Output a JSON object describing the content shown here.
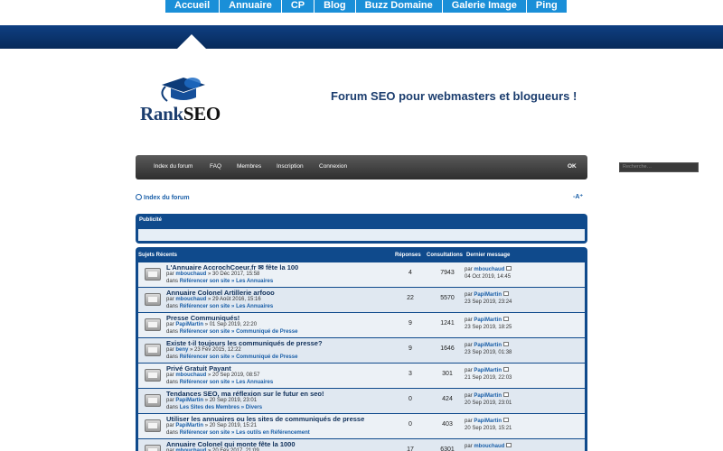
{
  "topnav": [
    "Accueil",
    "Annuaire",
    "CP",
    "Blog",
    "Buzz Domaine",
    "Galerie Image",
    "Ping"
  ],
  "logo": {
    "rank": "Rank",
    "seo": "SEO"
  },
  "tagline": "Forum SEO pour webmasters et blogueurs !",
  "forumnav": {
    "items": [
      "Index du forum",
      "FAQ",
      "Membres",
      "Inscription",
      "Connexion"
    ],
    "search_placeholder": "Recherche…",
    "ok": "OK"
  },
  "breadcrumb": "Index du forum",
  "fontsize": "-A⁺",
  "pub_title": "Publicité",
  "topics_header": {
    "sujets": "Sujets Récents",
    "reponses": "Réponses",
    "consultations": "Consultations",
    "dernier": "Dernier message"
  },
  "rows": [
    {
      "title": "L'Annuaire AccrochCoeur.fr",
      "title_suffix": "fête la 100",
      "by": "par",
      "author": "mbouchaud",
      "date": "» 30 Déc 2017, 15:58",
      "dans": "dans",
      "forum": "Référencer son site",
      "sub": "Les Annuaires",
      "replies": "4",
      "views": "7943",
      "last_author": "mbouchaud",
      "last_date": "04 Oct 2019, 14:45"
    },
    {
      "title": "Annuaire Colonel Artillerie arfooo",
      "title_suffix": "",
      "by": "par",
      "author": "mbouchaud",
      "date": "» 29 Août 2016, 15:16",
      "dans": "dans",
      "forum": "Référencer son site",
      "sub": "Les Annuaires",
      "replies": "22",
      "views": "5570",
      "last_author": "PapiMartin",
      "last_date": "23 Sep 2019, 23:24"
    },
    {
      "title": "Presse Communiqués!",
      "title_suffix": "",
      "by": "par",
      "author": "PapiMartin",
      "date": "» 01 Sep 2019, 22:20",
      "dans": "dans",
      "forum": "Référencer son site",
      "sub": "Communiqué de Presse",
      "replies": "9",
      "views": "1241",
      "last_author": "PapiMartin",
      "last_date": "23 Sep 2019, 18:25"
    },
    {
      "title": "Existe t-il toujours les communiqués de presse?",
      "title_suffix": "",
      "by": "par",
      "author": "beny",
      "date": "» 23 Fév 2015, 12:22",
      "dans": "dans",
      "forum": "Référencer son site",
      "sub": "Communiqué de Presse",
      "replies": "9",
      "views": "1646",
      "last_author": "PapiMartin",
      "last_date": "23 Sep 2019, 01:38"
    },
    {
      "title": "Privé Gratuit Payant",
      "title_suffix": "",
      "by": "par",
      "author": "mbouchaud",
      "date": "» 20 Sep 2019, 08:57",
      "dans": "dans",
      "forum": "Référencer son site",
      "sub": "Les Annuaires",
      "replies": "3",
      "views": "301",
      "last_author": "PapiMartin",
      "last_date": "21 Sep 2019, 22:03"
    },
    {
      "title": "Tendances SEO, ma réflexion sur le futur en seo!",
      "title_suffix": "",
      "by": "par",
      "author": "PapiMartin",
      "date": "» 20 Sep 2019, 23:01",
      "dans": "dans",
      "forum": "Les Sites des Membres",
      "sub": "Divers",
      "replies": "0",
      "views": "424",
      "last_author": "PapiMartin",
      "last_date": "20 Sep 2019, 23:01"
    },
    {
      "title": "Utiliser les annuaires ou les sites de communiqués de presse",
      "title_suffix": "",
      "by": "par",
      "author": "PapiMartin",
      "date": "» 20 Sep 2019, 15:21",
      "dans": "dans",
      "forum": "Référencer son site",
      "sub": "Les outils en Référencement",
      "replies": "0",
      "views": "403",
      "last_author": "PapiMartin",
      "last_date": "20 Sep 2019, 15:21"
    },
    {
      "title": "Annuaire Colonel qui monte fête la 1000",
      "title_suffix": "",
      "by": "par",
      "author": "mbouchaud",
      "date": "» 20 Fév 2017, 21:09",
      "dans": "dans",
      "forum": "Référencer son site",
      "sub": "Les Annuaires",
      "replies": "17",
      "views": "6301",
      "last_author": "mbouchaud",
      "last_date": ""
    }
  ]
}
